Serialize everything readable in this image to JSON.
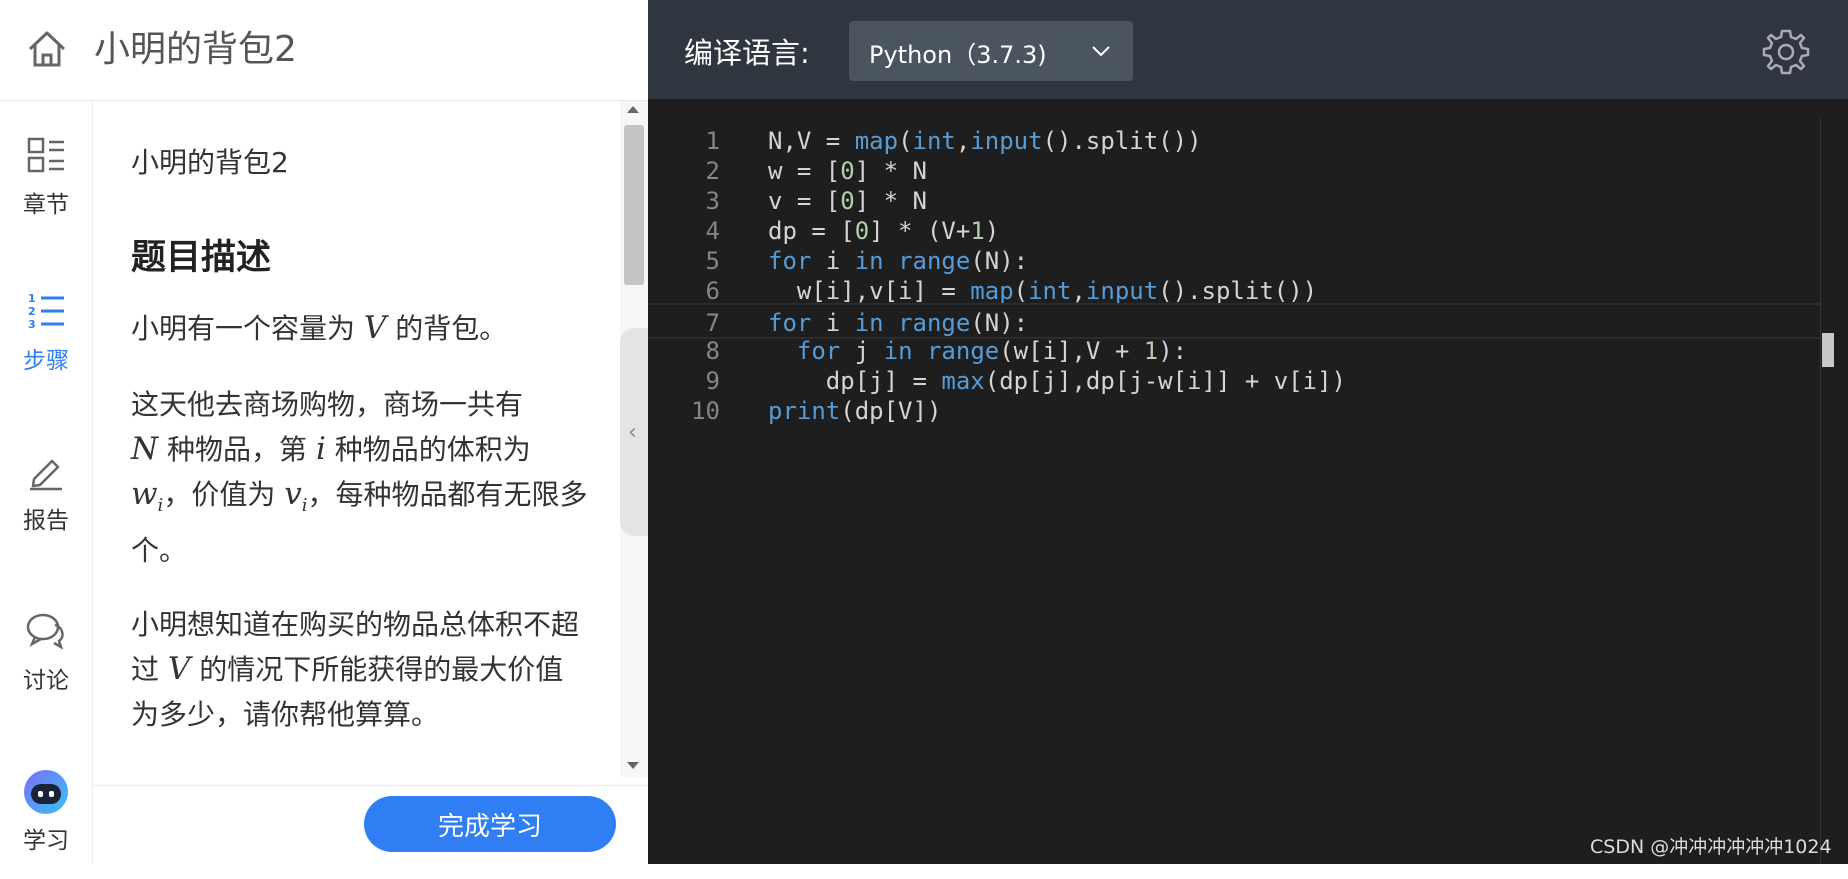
{
  "header": {
    "title": "小明的背包2"
  },
  "nav": {
    "items": [
      {
        "label": "章节",
        "icon": "chapters-icon"
      },
      {
        "label": "步骤",
        "icon": "steps-icon",
        "active": true
      },
      {
        "label": "报告",
        "icon": "pencil-icon"
      },
      {
        "label": "讨论",
        "icon": "chat-icon"
      },
      {
        "label": "学习",
        "icon": "robot-avatar-icon"
      }
    ]
  },
  "problem": {
    "title": "小明的背包2",
    "section_heading": "题目描述",
    "p1": {
      "before": "小明有一个容量为 ",
      "var_v": "V",
      "after": " 的背包。"
    },
    "p2": {
      "text1": "这天他去商场购物，商场一共有",
      "var_n": "N",
      "text2": " 种物品，第 ",
      "var_i": "i",
      "text3": " 种物品的体积为",
      "var_w": "w",
      "sub_i1": "i",
      "text4": "，价值为 ",
      "var_vi": "v",
      "sub_i2": "i",
      "text5": "，每种物品都有无限多个。"
    },
    "p3": {
      "before": "小明想知道在购买的物品总体积不超过 ",
      "var_v": "V",
      "after": " 的情况下所能获得的最大价值为多少，请你帮他算算。"
    }
  },
  "finish_button": "完成学习",
  "editor": {
    "lang_label": "编译语言:",
    "lang_value": "Python（3.7.3)",
    "lines": [
      {
        "n": "1",
        "code": "N,V = map(int,input().split())"
      },
      {
        "n": "2",
        "code": "w = [0] * N"
      },
      {
        "n": "3",
        "code": "v = [0] * N"
      },
      {
        "n": "4",
        "code": "dp = [0] * (V+1)"
      },
      {
        "n": "5",
        "code": "for i in range(N):"
      },
      {
        "n": "6",
        "code": "  w[i],v[i] = map(int,input().split())"
      },
      {
        "n": "7",
        "code": "for i in range(N):"
      },
      {
        "n": "8",
        "code": "  for j in range(w[i],V + 1):"
      },
      {
        "n": "9",
        "code": "    dp[j] = max(dp[j],dp[j-w[i]] + v[i])"
      },
      {
        "n": "10",
        "code": "print(dp[V])"
      }
    ]
  },
  "watermark": "CSDN @冲冲冲冲冲冲1024",
  "colors": {
    "accent": "#2f7ef3",
    "editor_bg": "#1e1e1e",
    "header_bg": "#2f3640",
    "keyword": "#569cd6",
    "number": "#b5cea8"
  }
}
